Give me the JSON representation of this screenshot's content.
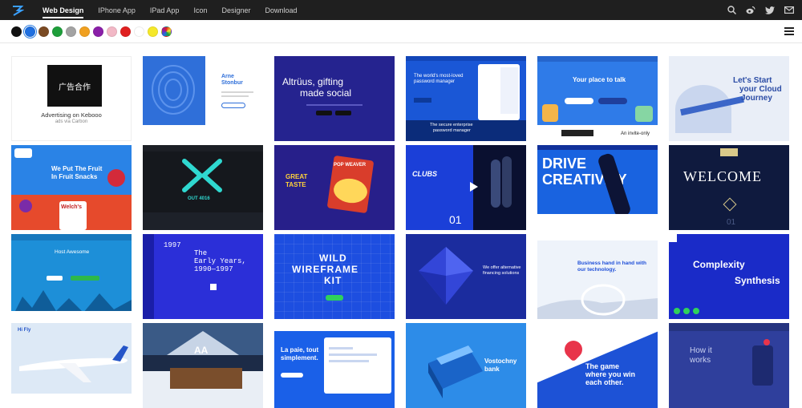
{
  "nav": {
    "items": [
      {
        "label": "Web Design",
        "active": true
      },
      {
        "label": "IPhone App",
        "active": false
      },
      {
        "label": "IPad App",
        "active": false
      },
      {
        "label": "Icon",
        "active": false
      },
      {
        "label": "Designer",
        "active": false
      },
      {
        "label": "Download",
        "active": false
      }
    ],
    "right_icons": [
      "search-icon",
      "weibo-icon",
      "twitter-icon",
      "mail-icon"
    ]
  },
  "colors": [
    "#111111",
    "#1f6fe0",
    "#7a4a23",
    "#1e9e3a",
    "#a3a3a3",
    "#8a1fa8",
    "#f2b8c6",
    "#e02020",
    "#ffffff",
    "#f5e82a",
    "rainbow"
  ],
  "selected_color_index": 1,
  "ad": {
    "image_text": "广告合作",
    "title": "Advertising on Kebooo",
    "subtitle": "ads via Carbon"
  },
  "cards": [
    {
      "name": "arne-stonbur",
      "bg": "#ffffff",
      "texts": [
        "Arne",
        "Stonbur"
      ]
    },
    {
      "name": "altruus",
      "bg": "#25238f",
      "texts": [
        "Altrüus, gifting",
        "made social"
      ]
    },
    {
      "name": "password-manager",
      "bg": "#1a57d6",
      "texts": [
        "The world's most-loved",
        "password manager",
        "The secure enterprise",
        "password manager"
      ]
    },
    {
      "name": "your-place-to-talk",
      "bg": "#2f7be8",
      "texts": [
        "Your place to talk",
        "An invite-only"
      ]
    },
    {
      "name": "cloud-journey",
      "bg": "#e9eef7",
      "texts": [
        "Let's Start",
        "your Cloud",
        "Journey"
      ]
    },
    {
      "name": "fruit-snacks",
      "bg": "#2a83e6",
      "texts": [
        "We Put The Fruit",
        "In Fruit Snacks",
        "Welch's"
      ]
    },
    {
      "name": "dark-x",
      "bg": "#15181d",
      "texts": [
        "OUT 4016"
      ]
    },
    {
      "name": "great-taste",
      "bg": "#271f8a",
      "texts": [
        "GREAT",
        "TASTE",
        "POP WEAVER"
      ]
    },
    {
      "name": "clubs",
      "bg": "#1b3fd8",
      "texts": [
        "CLUBS",
        "01"
      ]
    },
    {
      "name": "drive-creativity",
      "bg": "#1963e0",
      "texts": [
        "DRIVE",
        "CREATIVITY"
      ]
    },
    {
      "name": "welcome",
      "bg": "#0f1a3e",
      "texts": [
        "WELCOME",
        "01"
      ]
    },
    {
      "name": "hosting-cloud",
      "bg": "#1d8fd8",
      "texts": [
        "Host Awesome"
      ]
    },
    {
      "name": "early-years",
      "bg": "#2b2fd8",
      "texts": [
        "1997",
        "The",
        "Early Years,",
        "1990—1997"
      ]
    },
    {
      "name": "wireframe-kit",
      "bg": "#1d4ee0",
      "texts": [
        "WILD",
        "WIREFRAME",
        "KIT"
      ]
    },
    {
      "name": "alternative-financing",
      "bg": "#1b2c9e",
      "texts": [
        "We offer alternative",
        "financing solutions"
      ]
    },
    {
      "name": "business-hand",
      "bg": "#eef3fa",
      "texts": [
        "Business hand in hand with",
        "our technology."
      ]
    },
    {
      "name": "complexity-synthesis",
      "bg": "#1a2bc8",
      "texts": [
        "Complexity",
        "Synthesis"
      ]
    },
    {
      "name": "airline",
      "bg": "#dde9f6",
      "texts": [
        "Hi Fly"
      ]
    },
    {
      "name": "architecture-snow",
      "bg": "#1c2b47",
      "texts": [
        "AA"
      ]
    },
    {
      "name": "la-paie",
      "bg": "#1a60e8",
      "texts": [
        "La paie, tout",
        "simplement."
      ]
    },
    {
      "name": "vostochny-bank",
      "bg": "#2d8ce8",
      "texts": [
        "Vostochny",
        "bank"
      ]
    },
    {
      "name": "game-win",
      "bg": "#1d52d6",
      "texts": [
        "The game",
        "where you win",
        "each other."
      ]
    },
    {
      "name": "how-it-works",
      "bg": "#2f3f9c",
      "texts": [
        "How it",
        "works"
      ]
    }
  ]
}
